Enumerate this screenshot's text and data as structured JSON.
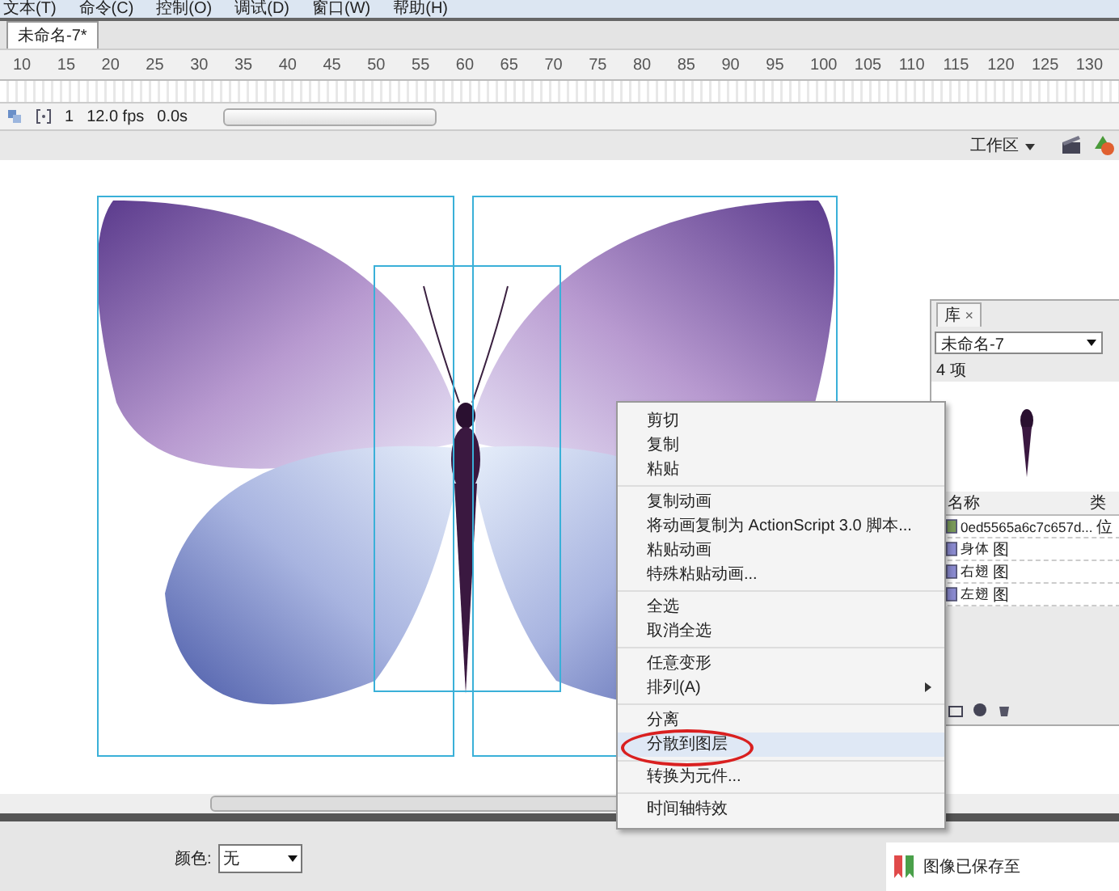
{
  "menu_bar": {
    "items": [
      "文本(T)",
      "命令(C)",
      "控制(O)",
      "调试(D)",
      "窗口(W)",
      "帮助(H)"
    ]
  },
  "document_tabs": [
    {
      "label": "未命名-7*",
      "selected": true
    }
  ],
  "timeline": {
    "ruler_ticks": [
      "10",
      "15",
      "20",
      "25",
      "30",
      "35",
      "40",
      "45",
      "50",
      "55",
      "60",
      "65",
      "70",
      "75",
      "80",
      "85",
      "90",
      "95",
      "100",
      "105",
      "110",
      "115",
      "120",
      "125",
      "130"
    ],
    "current_frame": "1",
    "frame_rate": "12.0 fps",
    "elapsed_time": "0.0s"
  },
  "toolbar": {
    "workspace": "工作区"
  },
  "context_menu": {
    "groups": [
      [
        {
          "label": "剪切",
          "has_submenu": false,
          "selected": false
        },
        {
          "label": "复制",
          "has_submenu": false,
          "selected": false
        },
        {
          "label": "粘贴",
          "has_submenu": false,
          "selected": false
        }
      ],
      [
        {
          "label": "复制动画",
          "has_submenu": false,
          "selected": false
        },
        {
          "label": "将动画复制为 ActionScript 3.0 脚本...",
          "has_submenu": false,
          "selected": false
        },
        {
          "label": "粘贴动画",
          "has_submenu": false,
          "selected": false
        },
        {
          "label": "特殊粘贴动画...",
          "has_submenu": false,
          "selected": false
        }
      ],
      [
        {
          "label": "全选",
          "has_submenu": false,
          "selected": false
        },
        {
          "label": "取消全选",
          "has_submenu": false,
          "selected": false
        }
      ],
      [
        {
          "label": "任意变形",
          "has_submenu": false,
          "selected": false
        },
        {
          "label": "排列(A)",
          "has_submenu": true,
          "selected": false
        }
      ],
      [
        {
          "label": "分离",
          "has_submenu": false,
          "selected": false
        },
        {
          "label": "分散到图层",
          "has_submenu": false,
          "selected": true
        }
      ],
      [
        {
          "label": "转换为元件...",
          "has_submenu": false,
          "selected": false
        }
      ],
      [
        {
          "label": "时间轴特效",
          "has_submenu": false,
          "selected": false
        }
      ]
    ]
  },
  "library": {
    "tab": "库",
    "close": "×",
    "document": "未命名-7",
    "item_count": "4 项",
    "columns": [
      "名称",
      "类"
    ],
    "rows": [
      {
        "name": "0ed5565a6c7c657d...",
        "type": "位",
        "kind": "bitmap"
      },
      {
        "name": "身体",
        "type": "图",
        "kind": "graphic"
      },
      {
        "name": "右翅",
        "type": "图",
        "kind": "graphic"
      },
      {
        "name": "左翅",
        "type": "图",
        "kind": "graphic"
      }
    ]
  },
  "properties": {
    "color_label": "颜色:",
    "color_value": "无"
  },
  "notification": {
    "text": "图像已保存至"
  }
}
